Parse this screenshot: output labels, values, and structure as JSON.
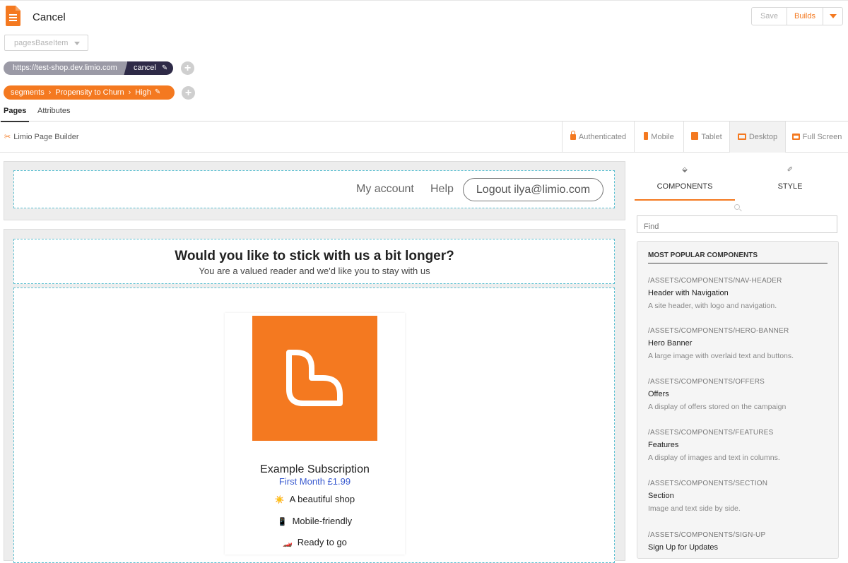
{
  "header": {
    "title": "Cancel",
    "save_label": "Save",
    "builds_label": "Builds",
    "base_select": "pagesBaseItem"
  },
  "breadcrumbs": {
    "url": "https://test-shop.dev.limio.com",
    "page": "cancel",
    "segments": [
      "segments",
      "Propensity to Churn",
      "High"
    ]
  },
  "tabs": [
    "Pages",
    "Attributes"
  ],
  "toolbar": {
    "builder_label": "Limio Page Builder",
    "devices": [
      "Authenticated",
      "Mobile",
      "Tablet",
      "Desktop",
      "Full Screen"
    ],
    "active_device": "Desktop"
  },
  "preview": {
    "nav": {
      "my_account": "My account",
      "help": "Help",
      "logout": "Logout ilya@limio.com"
    },
    "hero": {
      "title": "Would you like to stick with us a bit longer?",
      "subtitle": "You are a valued reader and we'd like you to stay with us"
    },
    "offer": {
      "name": "Example Subscription",
      "price": "First Month £1.99",
      "features": [
        {
          "emoji": "☀️",
          "text": "A beautiful shop"
        },
        {
          "emoji": "📱",
          "text": "Mobile-friendly"
        },
        {
          "emoji": "🏎️",
          "text": "Ready to go"
        }
      ],
      "brand_color": "#f47920"
    }
  },
  "panel": {
    "tabs": [
      "COMPONENTS",
      "STYLE"
    ],
    "active_tab": "COMPONENTS",
    "search_placeholder": "Find",
    "heading": "MOST POPULAR COMPONENTS",
    "components": [
      {
        "path": "/ASSETS/COMPONENTS/NAV-HEADER",
        "name": "Header with Navigation",
        "desc": "A site header, with logo and navigation."
      },
      {
        "path": "/ASSETS/COMPONENTS/HERO-BANNER",
        "name": "Hero Banner",
        "desc": "A large image with overlaid text and buttons."
      },
      {
        "path": "/ASSETS/COMPONENTS/OFFERS",
        "name": "Offers",
        "desc": "A display of offers stored on the campaign"
      },
      {
        "path": "/ASSETS/COMPONENTS/FEATURES",
        "name": "Features",
        "desc": "A display of images and text in columns."
      },
      {
        "path": "/ASSETS/COMPONENTS/SECTION",
        "name": "Section",
        "desc": "Image and text side by side."
      },
      {
        "path": "/ASSETS/COMPONENTS/SIGN-UP",
        "name": "Sign Up for Updates",
        "desc": ""
      }
    ]
  },
  "colors": {
    "accent": "#f47920",
    "dark": "#2e2a47",
    "link": "#3a5bd0",
    "dropzone": "#5bbfd0"
  }
}
